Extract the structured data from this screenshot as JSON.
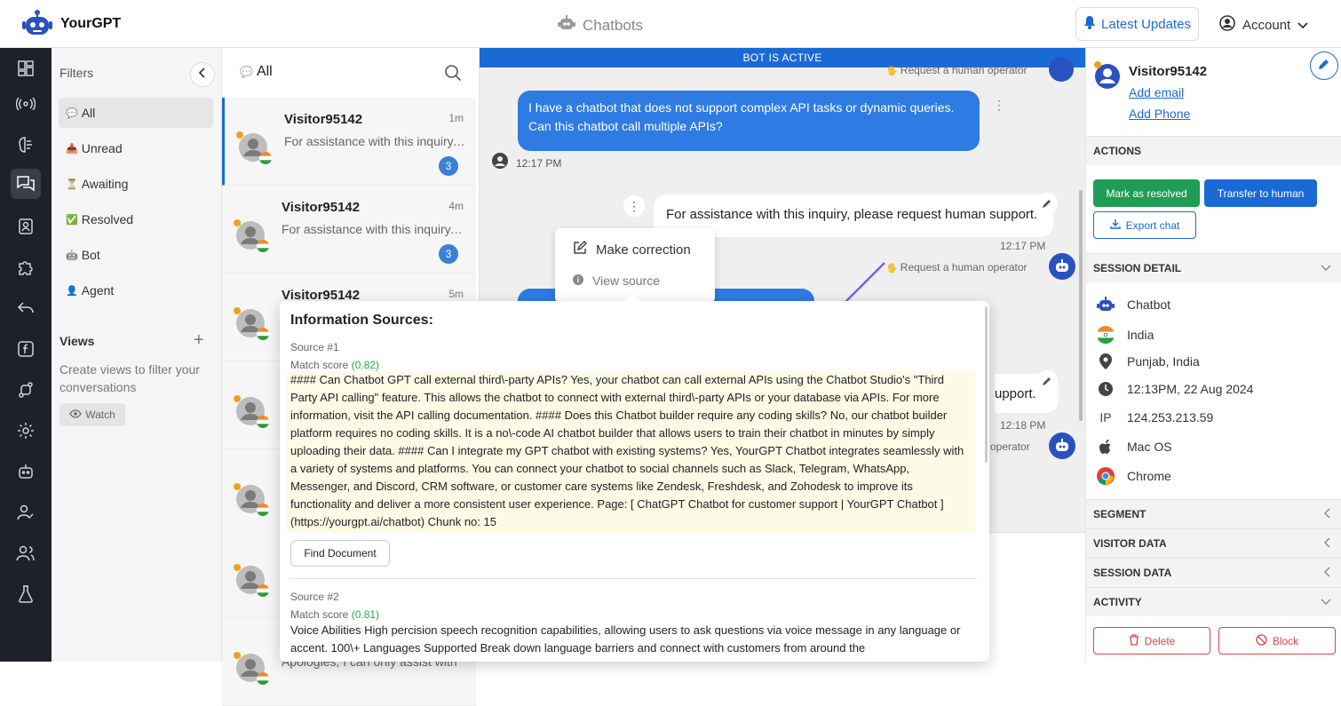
{
  "app": {
    "brand": "YourGPT",
    "center_title": "Chatbots",
    "latest_updates": "Latest Updates",
    "account": "Account"
  },
  "filters": {
    "title": "Filters",
    "items": [
      {
        "label": "All",
        "emoji": "💬"
      },
      {
        "label": "Unread",
        "emoji": "📥"
      },
      {
        "label": "Awaiting",
        "emoji": "⏳"
      },
      {
        "label": "Resolved",
        "emoji": "✅"
      },
      {
        "label": "Bot",
        "emoji": "🤖"
      },
      {
        "label": "Agent",
        "emoji": "👤"
      }
    ],
    "views_title": "Views",
    "views_hint": "Create views to filter your conversations",
    "watch_label": "Watch"
  },
  "conversations": {
    "header": "All",
    "items": [
      {
        "name": "Visitor95142",
        "time": "1m",
        "preview": "For assistance with this inquiry, please request human support.",
        "badge": "3"
      },
      {
        "name": "Visitor95142",
        "time": "4m",
        "preview": "For assistance with this inquiry, please request human support.",
        "badge": "3"
      },
      {
        "name": "Visitor95142",
        "time": "5m",
        "preview": "",
        "badge": ""
      },
      {
        "name": "",
        "time": "",
        "preview": "",
        "badge": ""
      },
      {
        "name": "",
        "time": "",
        "preview": "",
        "badge": ""
      },
      {
        "name": "",
        "time": "",
        "preview": "",
        "badge": ""
      },
      {
        "name": "",
        "time": "",
        "preview": "Apologies, I can only assist with",
        "badge": ""
      }
    ]
  },
  "chat": {
    "status": "BOT IS ACTIVE",
    "request_human": "Request a human operator",
    "user_msg": "I have a chatbot that does not support complex API tasks or dynamic queries. Can this chatbot call multiple APIs?",
    "user_time": "12:17 PM",
    "bot_msg": "For assistance with this inquiry, please request human support.",
    "bot_time": "12:17 PM",
    "bot_msg_partial": "upport.",
    "bot_time2": "12:18 PM",
    "operator_partial": "operator",
    "menu": {
      "correction": "Make correction",
      "view_source": "View source"
    }
  },
  "sources": {
    "title": "Information Sources:",
    "items": [
      {
        "label": "Source #1",
        "match_label": "Match score",
        "score": "(0.82)",
        "text": "#### Can Chatbot GPT call external third\\-party APIs? Yes, your chatbot can call external APIs using the Chatbot Studio's \"Third Party API calling\" feature. This allows the chatbot to connect with external third\\-party APIs or your database via APIs. For more information, visit the API calling documentation. #### Does this Chatbot builder require any coding skills? No, our chatbot builder platform requires no coding skills. It is a no\\-code AI chatbot builder that allows users to train their chatbot in minutes by simply uploading their data. #### Can I integrate my GPT chatbot with existing systems? Yes, YourGPT Chatbot integrates seamlessly with a variety of systems and platforms. You can connect your chatbot to social channels such as Slack, Telegram, WhatsApp, Messenger, and Discord, CRM software, or customer care systems like Zendesk, Freshdesk, and Zohodesk to improve its functionality and deliver a more consistent user experience. Page: [ ChatGPT Chatbot for customer support | YourGPT Chatbot ](https://yourgpt.ai/chatbot) Chunk no: 15"
      },
      {
        "label": "Source #2",
        "match_label": "Match score",
        "score": "(0.81)",
        "text": "Voice Abilities High percision speech recognition capabilities, allowing users to ask questions via voice message in any language or accent. 100\\+ Languages Supported Break down language barriers and connect with customers from around the"
      }
    ],
    "find_document": "Find Document"
  },
  "visitor": {
    "name": "Visitor95142",
    "add_email": "Add email",
    "add_phone": "Add Phone",
    "actions_title": "ACTIONS",
    "mark_resolved": "Mark as resolved",
    "transfer": "Transfer to human",
    "export": "Export chat",
    "session_detail_title": "SESSION DETAIL",
    "details": [
      {
        "icon": "robot-icon",
        "value": "Chatbot"
      },
      {
        "icon": "india-flag-icon",
        "value": "India"
      },
      {
        "icon": "location-pin-icon",
        "value": "Punjab, India"
      },
      {
        "icon": "clock-icon",
        "value": "12:13PM, 22 Aug 2024"
      },
      {
        "icon": "ip-icon",
        "value": "124.253.213.59",
        "prefix": "IP"
      },
      {
        "icon": "apple-icon",
        "value": "Mac OS"
      },
      {
        "icon": "chrome-icon",
        "value": "Chrome"
      }
    ],
    "sections": [
      "SEGMENT",
      "VISITOR DATA",
      "SESSION DATA",
      "ACTIVITY"
    ],
    "delete": "Delete",
    "block": "Block"
  },
  "colors": {
    "accent": "#1a6ad6",
    "success": "#1f9d55",
    "danger": "#d64545",
    "rail": "#1e2128",
    "arrow": "#7b5cf0"
  }
}
